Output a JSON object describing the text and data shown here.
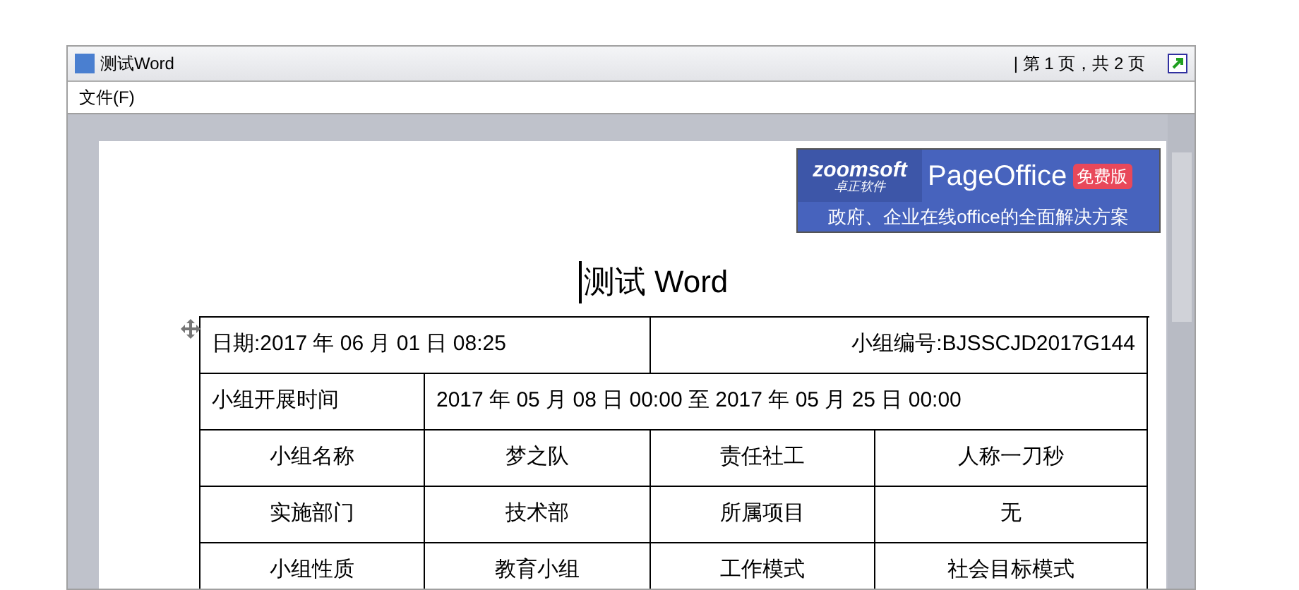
{
  "window": {
    "title": "测试Word",
    "page_indicator": "| 第 1 页，共 2 页"
  },
  "menu": [
    "文件(F)"
  ],
  "banner": {
    "logo": "zoomsoft",
    "logo_sub": "卓正软件",
    "product": "PageOffice",
    "badge": "免费版",
    "slogan": "政府、企业在线office的全面解决方案"
  },
  "document": {
    "title": "测试 Word",
    "rows": [
      {
        "kind": "split",
        "cells": [
          "日期:2017 年 06 月 01 日  08:25",
          "小组编号:BJSSCJD2017G144"
        ]
      },
      {
        "kind": "label",
        "cells": [
          "小组开展时间",
          "2017 年 05 月 08 日  00:00 至 2017 年 05 月 25 日  00:00"
        ]
      },
      {
        "kind": "four",
        "cells": [
          "小组名称",
          "梦之队",
          "责任社工",
          "人称一刀秒"
        ]
      },
      {
        "kind": "four",
        "cells": [
          "实施部门",
          "技术部",
          "所属项目",
          "无"
        ]
      },
      {
        "kind": "four",
        "cells": [
          "小组性质",
          "教育小组",
          "工作模式",
          "社会目标模式"
        ]
      }
    ]
  }
}
